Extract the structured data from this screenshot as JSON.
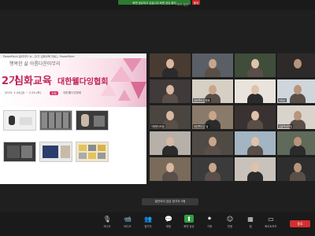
{
  "top_bar": {
    "share_banner": "화면 공유하고 있습니다 화면 공유 중지",
    "stop_share_label": "중지",
    "view_menu_label": "보기 옵션"
  },
  "ppt": {
    "window_title": "PowerPoint 슬라이드 쇼 - [2기 심화교육 자료] - PowerPoint",
    "tagline": "행복한 삶 아름다운마무리",
    "title_num": "2기",
    "title_main": "심화교육",
    "org": "대한웰다잉협회",
    "date": "2023. 2.24(금) ~ 2.25.(토)",
    "host_badge": "주최",
    "host_name": "대한웰다잉협회"
  },
  "participants": [
    {
      "name": "",
      "color": "#4a3b32"
    },
    {
      "name": "",
      "color": "#5a5f66"
    },
    {
      "name": "",
      "color": "#3f4d3a"
    },
    {
      "name": "",
      "color": "#2f2a2a"
    },
    {
      "name": "",
      "color": "#403a3a"
    },
    {
      "name": "대한웰다잉협회",
      "color": "#d6cfc4"
    },
    {
      "name": "",
      "color": "#e8e3dc"
    },
    {
      "name": "이화순",
      "color": "#cfd6db"
    },
    {
      "name": "이향준(조장)",
      "color": "#4b4540"
    },
    {
      "name": "대한웰다잉 남",
      "color": "#8a7a6a"
    },
    {
      "name": "",
      "color": "#3a3232"
    },
    {
      "name": "김춘옥(부천)",
      "color": "#d8d4cc"
    },
    {
      "name": "",
      "color": "#b6b0a8"
    },
    {
      "name": "",
      "color": "#4f4a44"
    },
    {
      "name": "",
      "color": "#a3b4c2"
    },
    {
      "name": "",
      "color": "#5f6a5a"
    },
    {
      "name": "",
      "color": "#7a6a5a"
    },
    {
      "name": "",
      "color": "#3b3b3b"
    },
    {
      "name": "",
      "color": "#c8c2bb"
    },
    {
      "name": "",
      "color": "#2e2e2e"
    },
    {
      "name": "",
      "color": "#cfc8c0"
    },
    {
      "name": "",
      "color": "#e6e0d8"
    },
    {
      "name": "",
      "color": "#6d6259"
    },
    {
      "name": "",
      "color": "#d8d2ca"
    },
    {
      "name": "",
      "color": "#dddad5"
    }
  ],
  "tooltip": "발언되지 않은 참가자 4명",
  "toolbar": {
    "items": [
      {
        "label": "오디오",
        "icon": "microphone-icon"
      },
      {
        "label": "비디오",
        "icon": "video-camera-icon"
      },
      {
        "label": "참가자",
        "icon": "participants-icon"
      },
      {
        "label": "채팅",
        "icon": "chat-icon"
      },
      {
        "label": "화면 공유",
        "icon": "share-screen-icon"
      },
      {
        "label": "기록",
        "icon": "record-icon"
      },
      {
        "label": "반응",
        "icon": "reactions-icon"
      },
      {
        "label": "앱",
        "icon": "apps-icon"
      },
      {
        "label": "화이트보드",
        "icon": "whiteboard-icon"
      }
    ],
    "end_label": "종료",
    "share_color": "#2ea043",
    "end_color": "#d32f2f"
  }
}
